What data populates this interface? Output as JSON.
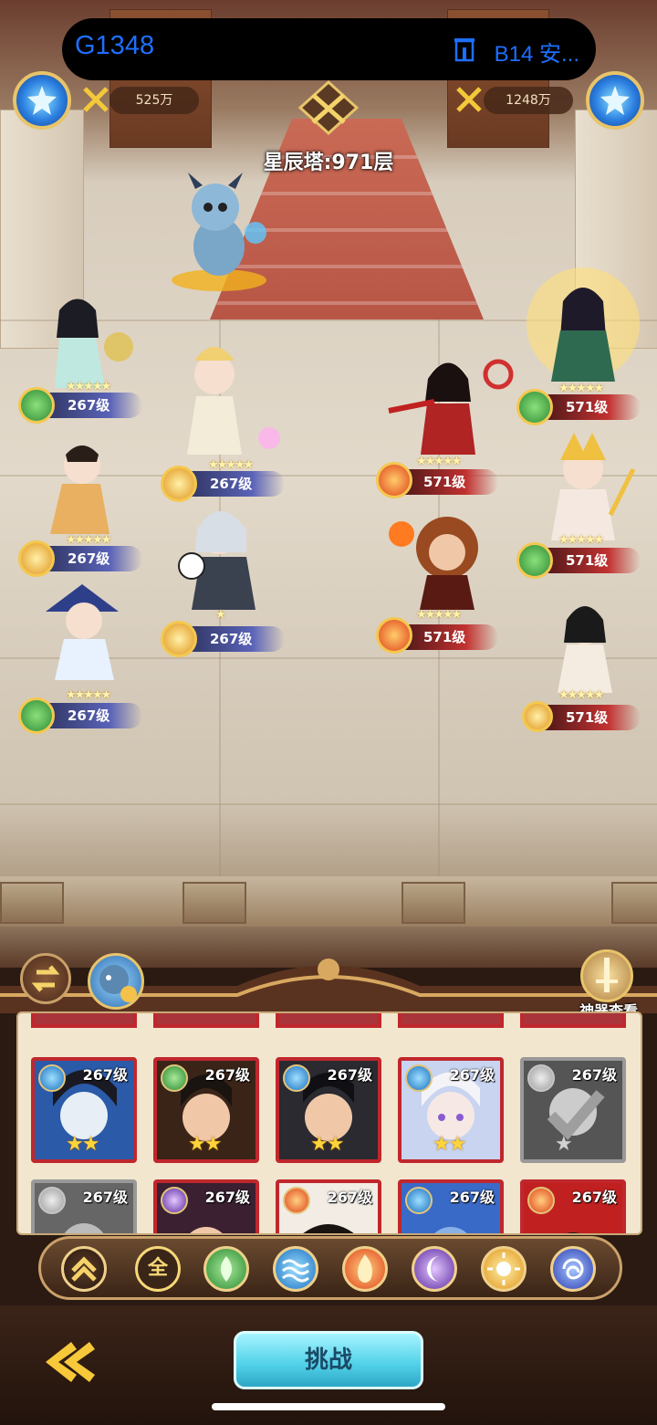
{
  "status_bar": {
    "server_id": "G1348",
    "server_name": "B14 安..."
  },
  "left_team": {
    "power": "525万",
    "level": "267级"
  },
  "right_team": {
    "power": "1248万",
    "level": "571级"
  },
  "tower": {
    "label": "星辰塔:971层"
  },
  "roster": {
    "cards": [
      {
        "level": "267级",
        "element": "water",
        "stars": "★★"
      },
      {
        "level": "267级",
        "element": "nature",
        "stars": "★★"
      },
      {
        "level": "267级",
        "element": "water",
        "stars": "★★"
      },
      {
        "level": "267级",
        "element": "water",
        "stars": "★★"
      },
      {
        "level": "267级",
        "element": "light",
        "stars": "★",
        "used": true
      },
      {
        "level": "267级",
        "element": "light",
        "stars": "",
        "used": true
      },
      {
        "level": "267级",
        "element": "dark",
        "stars": ""
      },
      {
        "level": "267级",
        "element": "fire",
        "stars": ""
      },
      {
        "level": "267级",
        "element": "water",
        "stars": ""
      },
      {
        "level": "267级",
        "element": "fire",
        "stars": ""
      }
    ]
  },
  "filters": {
    "all_label": "全"
  },
  "artifact": {
    "label": "神器查看"
  },
  "challenge": {
    "label": "挑战"
  },
  "colors": {
    "accent_blue": "#1e6fff",
    "challenge_cyan": "#4fd0e8",
    "card_red": "#c0272d"
  }
}
